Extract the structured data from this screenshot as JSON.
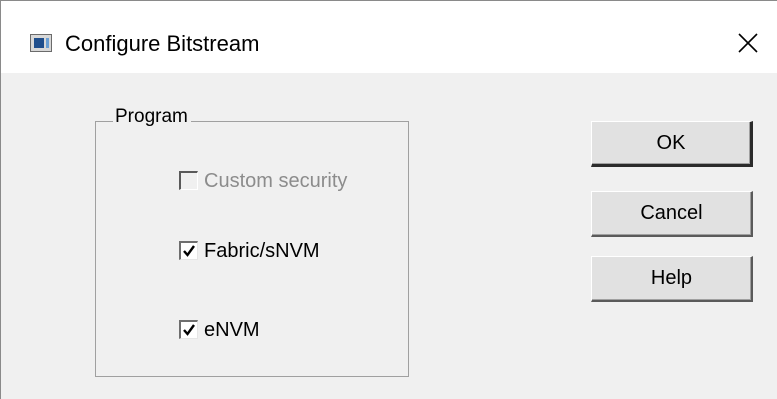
{
  "window": {
    "title": "Configure Bitstream",
    "close_icon": "close-icon",
    "app_icon": "application-icon"
  },
  "program_group": {
    "label": "Program",
    "options": [
      {
        "label": "Custom security",
        "checked": false,
        "enabled": false
      },
      {
        "label": "Fabric/sNVM",
        "checked": true,
        "enabled": true
      },
      {
        "label": "eNVM",
        "checked": true,
        "enabled": true
      }
    ]
  },
  "buttons": {
    "ok_label": "OK",
    "cancel_label": "Cancel",
    "help_label": "Help"
  }
}
